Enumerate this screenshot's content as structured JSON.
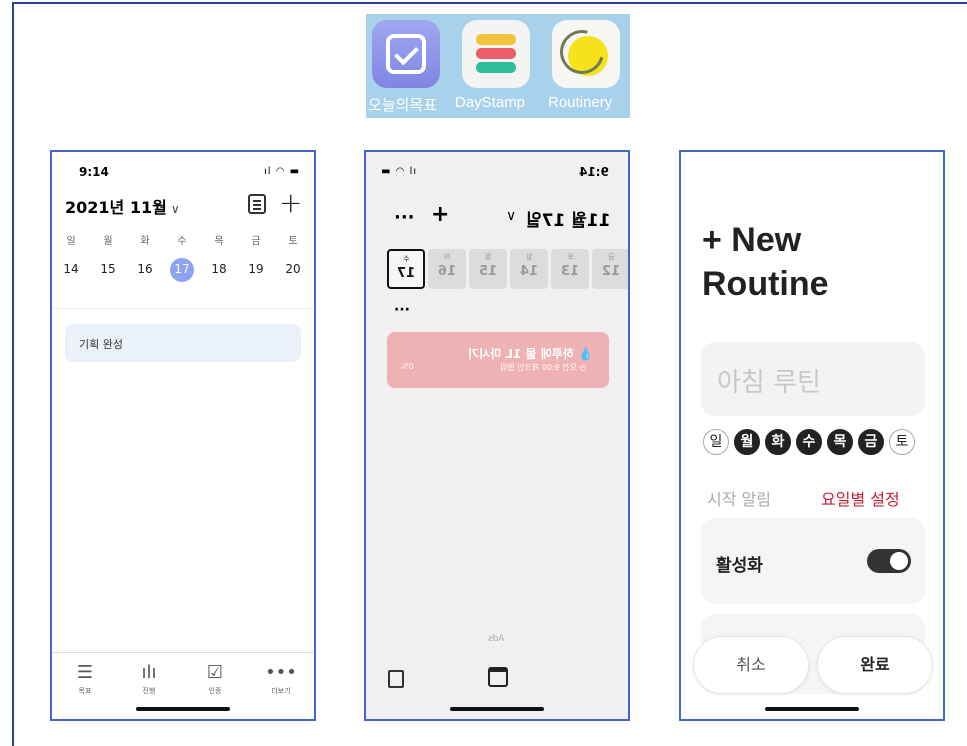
{
  "apps": [
    {
      "name": "오늘의목표",
      "icon": "checkbox-app-icon"
    },
    {
      "name": "DayStamp",
      "icon": "stripes-app-icon"
    },
    {
      "name": "Routinery",
      "icon": "sun-app-icon"
    }
  ],
  "screen1": {
    "time": "9:14",
    "month": "2021년 11월",
    "weekdays": [
      "일",
      "월",
      "화",
      "수",
      "목",
      "금",
      "토"
    ],
    "days": [
      "14",
      "15",
      "16",
      "17",
      "18",
      "19",
      "20"
    ],
    "selected_day": "17",
    "task": "기획 완성",
    "tabs": [
      "목표",
      "진행",
      "인증",
      "더보기"
    ]
  },
  "screen2": {
    "time": "9:14",
    "month": "11월 17일",
    "dates": [
      {
        "w": "수",
        "n": "17"
      },
      {
        "w": "화",
        "n": "16"
      },
      {
        "w": "월",
        "n": "15"
      },
      {
        "w": "일",
        "n": "14"
      },
      {
        "w": "토",
        "n": "13"
      },
      {
        "w": "금",
        "n": "12"
      }
    ],
    "habit_title": "하루에 물 1L 마시기",
    "habit_detail": "오전 9:00 체크인 알림",
    "habit_progress": "0%",
    "ads_label": "Ads"
  },
  "screen3": {
    "title_line1": "+ New",
    "title_line2": "Routine",
    "name_placeholder": "아침 루틴",
    "days": [
      "일",
      "월",
      "화",
      "수",
      "목",
      "금",
      "토"
    ],
    "days_active": [
      false,
      true,
      true,
      true,
      true,
      true,
      false
    ],
    "alarm_label": "시작 알림",
    "day_setting_link": "요일별 설정",
    "activate_label": "활성화",
    "activate_on": true,
    "cancel": "취소",
    "done": "완료"
  }
}
